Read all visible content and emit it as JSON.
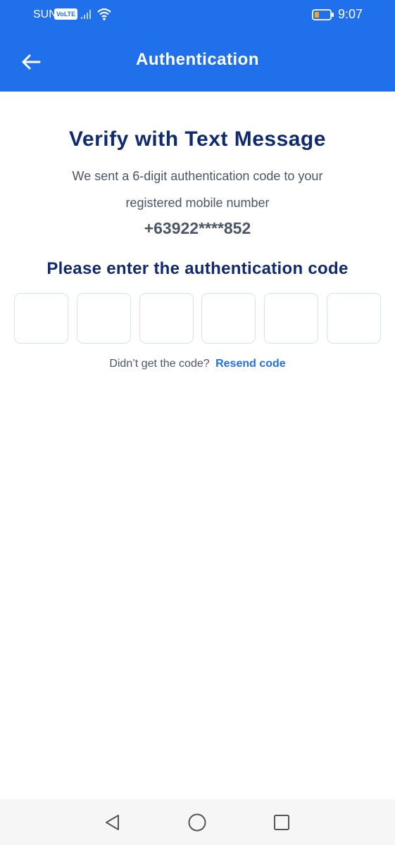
{
  "status_bar": {
    "carrier": "SUN",
    "network_badge": "VoLTE",
    "time": "9:07",
    "icons": [
      "signal-icon",
      "wifi-icon",
      "battery-icon"
    ]
  },
  "app_bar": {
    "title": "Authentication",
    "back_icon": "arrow-left-icon"
  },
  "main": {
    "heading": "Verify with Text Message",
    "description_line1": "We sent a 6-digit authentication code to your",
    "description_line2": "registered mobile number",
    "phone_number": "+63922****852",
    "prompt": "Please enter the authentication code",
    "code_digits": [
      "",
      "",
      "",
      "",
      "",
      ""
    ],
    "resend_question": "Didn’t get the code?",
    "resend_label": "Resend code"
  },
  "nav_bar": {
    "buttons": [
      "back-triangle-icon",
      "home-circle-icon",
      "recents-square-icon"
    ]
  },
  "colors": {
    "primary": "#1f70ea",
    "heading": "#0f2a6e",
    "body_text": "#4a5567",
    "input_border": "#d6e1ee"
  }
}
